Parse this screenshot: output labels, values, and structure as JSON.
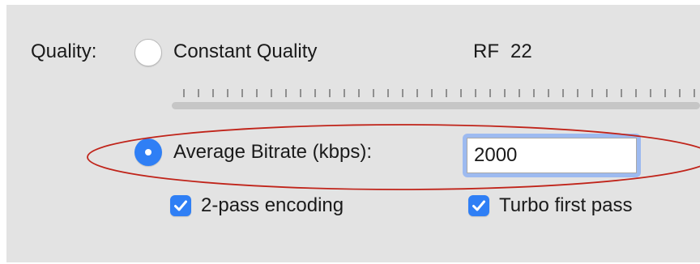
{
  "quality": {
    "label": "Quality:",
    "constant_quality_label": "Constant Quality",
    "constant_quality_selected": false,
    "rf_label": "RF",
    "rf_value": "22"
  },
  "bitrate": {
    "label": "Average Bitrate (kbps):",
    "selected": true,
    "value": "2000"
  },
  "options": {
    "two_pass_label": "2-pass encoding",
    "two_pass_checked": true,
    "turbo_label": "Turbo first pass",
    "turbo_checked": true
  },
  "colors": {
    "accent": "#2f7ff5",
    "annotation": "#c0241a",
    "panel_background": "#e3e3e3"
  },
  "icons": {
    "radio_unselected": "radio-off-icon",
    "radio_selected": "radio-on-icon",
    "checkbox_checked": "checkmark-icon"
  }
}
